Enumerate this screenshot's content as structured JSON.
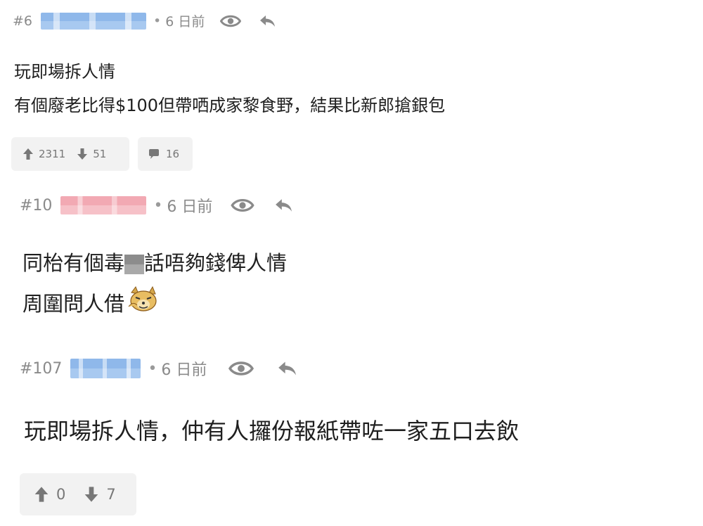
{
  "posts": [
    {
      "number": "#6",
      "time": "6 日前",
      "lines": [
        "玩即場拆人情",
        "有個廢老比得$100但帶哂成家黎食野，結果比新郎搶銀包"
      ],
      "upvotes": "2311",
      "downvotes": "51",
      "replies": "16"
    },
    {
      "number": "#10",
      "time": "6 日前",
      "line1_before": "同枱有個毒",
      "line1_after": "話唔夠錢俾人情",
      "line2": "周圍問人借"
    },
    {
      "number": "#107",
      "time": "6 日前",
      "lines": [
        "玩即場拆人情，仲有人攞份報紙帶咗一家五口去飲"
      ],
      "upvotes": "0",
      "downvotes": "7"
    }
  ],
  "icons": {
    "view": "eye-icon",
    "reply": "reply-arrow-icon",
    "up": "arrow-up-icon",
    "down": "arrow-down-icon",
    "comment": "comment-bubble-icon",
    "emoji": "dog-emoji-icon"
  },
  "colors": {
    "meta": "#8a8a8a",
    "text": "#1f1f1f",
    "pill": "#f2f2f2"
  }
}
